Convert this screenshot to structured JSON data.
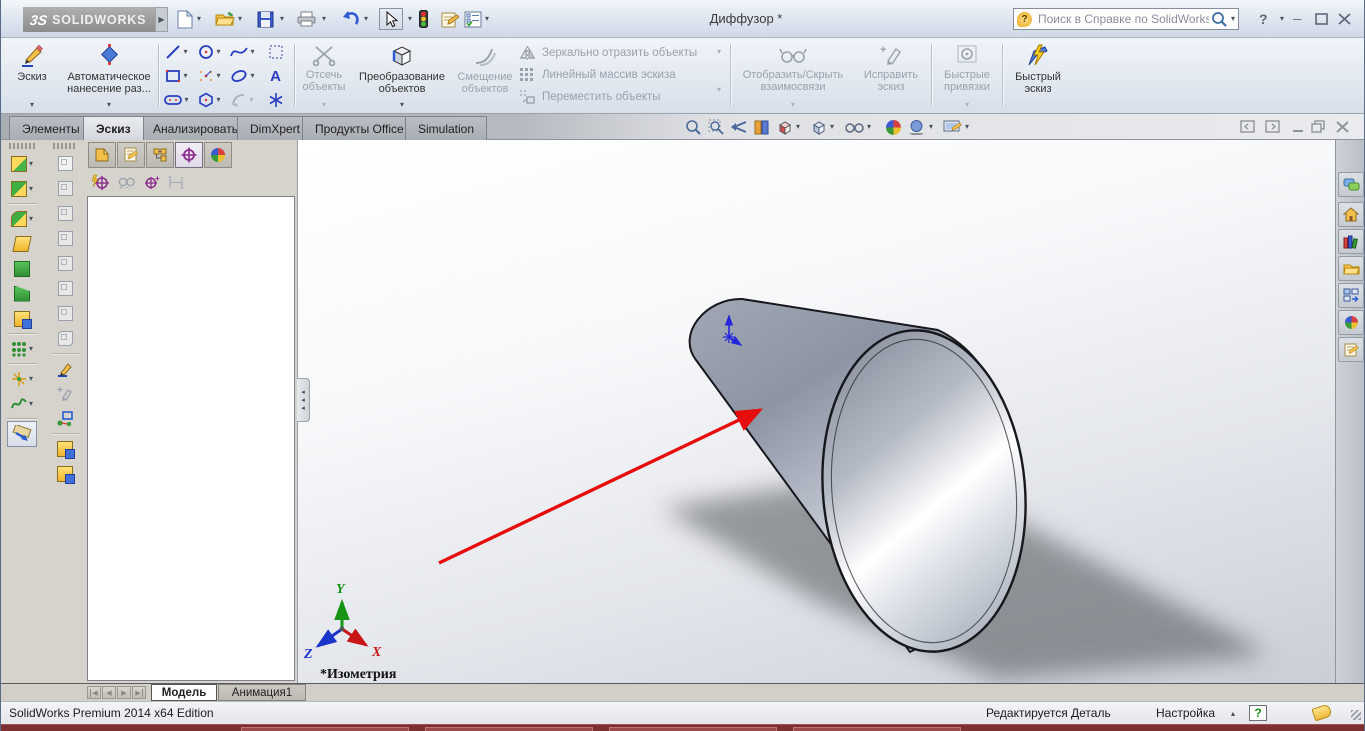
{
  "icons": {
    "dropdown": "▾",
    "up_arrow": "▴",
    "collapse_left": "◂",
    "nav_prev": "◀",
    "nav_next": "▶",
    "minimize_glyph": "─",
    "help_glyph": "?",
    "logo_mark": "3S",
    "search_balloon": "?"
  },
  "titlebar": {
    "document_title": "Диффузор *",
    "logo_text": "SOLIDWORKS",
    "search_placeholder": "Поиск в Справке по SolidWorks"
  },
  "ribbon": {
    "sketch": "Эскиз",
    "auto_dimension": "Автоматическое нанесение раз...",
    "trim": "Отсечь объекты",
    "convert": "Преобразование объектов",
    "offset": "Смещение объектов",
    "mirror": "Зеркально отразить объекты",
    "linear_pattern": "Линейный массив эскиза",
    "move": "Переместить объекты",
    "relations": "Отобразить/Скрыть взаимосвязи",
    "repair": "Исправить эскиз",
    "snaps": "Быстрые привязки",
    "rapid": "Быстрый эскиз",
    "text_tool": "A"
  },
  "command_tabs": {
    "items": [
      {
        "label": "Элементы"
      },
      {
        "label": "Эскиз"
      },
      {
        "label": "Анализировать"
      },
      {
        "label": "DimXpert"
      },
      {
        "label": "Продукты Office"
      },
      {
        "label": "Simulation"
      }
    ],
    "active": "Эскиз"
  },
  "viewport": {
    "view_label": "*Изометрия",
    "triad": {
      "x": "X",
      "y": "Y",
      "z": "Z"
    }
  },
  "model_tabs": {
    "model": "Модель",
    "animation": "Анимация1"
  },
  "statusbar": {
    "edition": "SolidWorks Premium 2014 x64 Edition",
    "editing": "Редактируется Деталь",
    "configuration": "Настройка"
  },
  "colors": {
    "arrow_red": "#e60d0d",
    "triad_x": "#c81616",
    "triad_y": "#169416",
    "triad_z": "#1a35c8",
    "origin_blue": "#2424dd",
    "dimxpert_purple": "#8c2d8c"
  }
}
